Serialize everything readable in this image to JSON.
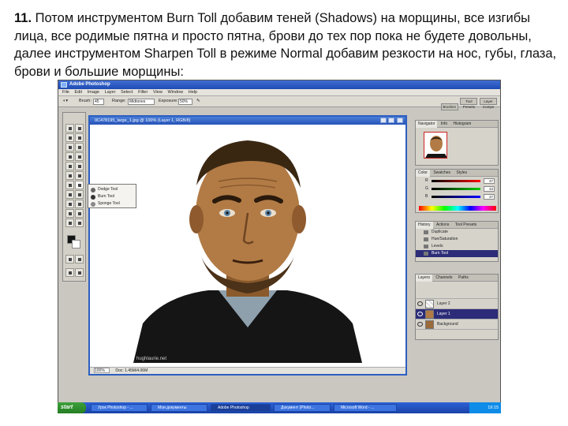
{
  "caption": {
    "number": "11.",
    "text": "Потом инструментом Burn Toll добавим теней (Shadows) на морщины, все изгибы лица, все родимые пятна и просто пятна, брови до тех пор пока не будете довольны, далее инструментом Sharpen Toll в режиме Normal добавим резкости на нос, губы, глаза, брови и большие морщины:"
  },
  "app": {
    "title": "Adobe Photoshop",
    "menu": [
      "File",
      "Edit",
      "Image",
      "Layer",
      "Select",
      "Filter",
      "View",
      "Window",
      "Help"
    ],
    "options": {
      "brush_label": "Brush:",
      "brush_size": "45",
      "range_label": "Range:",
      "range_value": "Midtones",
      "exposure_label": "Exposure:",
      "exposure_value": "50%"
    },
    "workspace_buttons": [
      "Brushes",
      "Tool Presets",
      "Layer Comps"
    ]
  },
  "tool_flyout": [
    "Dodge Tool",
    "Burn Tool",
    "Sponge Tool"
  ],
  "document": {
    "title": "0C478195_large_1.jpg @ 100% (Layer 1, RGB/8)",
    "zoom": "100%",
    "doc_size": "Doc: 1.45M/4.06M",
    "watermark": "hughlaurie.net"
  },
  "navigator": {
    "tabs": [
      "Navigator",
      "Info",
      "Histogram"
    ]
  },
  "color": {
    "tabs": [
      "Color",
      "Swatches",
      "Styles"
    ],
    "channels": [
      {
        "label": "R",
        "value": "37",
        "color": "#d23a3a"
      },
      {
        "label": "G",
        "value": "33",
        "color": "#3aa33a"
      },
      {
        "label": "B",
        "value": "37",
        "color": "#3a4fd2"
      }
    ]
  },
  "history": {
    "tabs": [
      "History",
      "Actions",
      "Tool Presets"
    ],
    "items": [
      "Duplicate",
      "Hue/Saturation",
      "Levels",
      "Burn Tool"
    ],
    "selected_index": 3
  },
  "layers": {
    "tabs": [
      "Layers",
      "Channels",
      "Paths"
    ],
    "items": [
      "Layer 2",
      "Layer 1",
      "Background"
    ],
    "selected_index": 1
  },
  "taskbar": {
    "start": "start",
    "tasks": [
      "Урок Photoshop - ...",
      "Мои документы",
      "Adobe Photoshop",
      "Документ (Photo...",
      "Microsoft Word - ..."
    ],
    "active_index": 2,
    "clock": "19:15"
  }
}
